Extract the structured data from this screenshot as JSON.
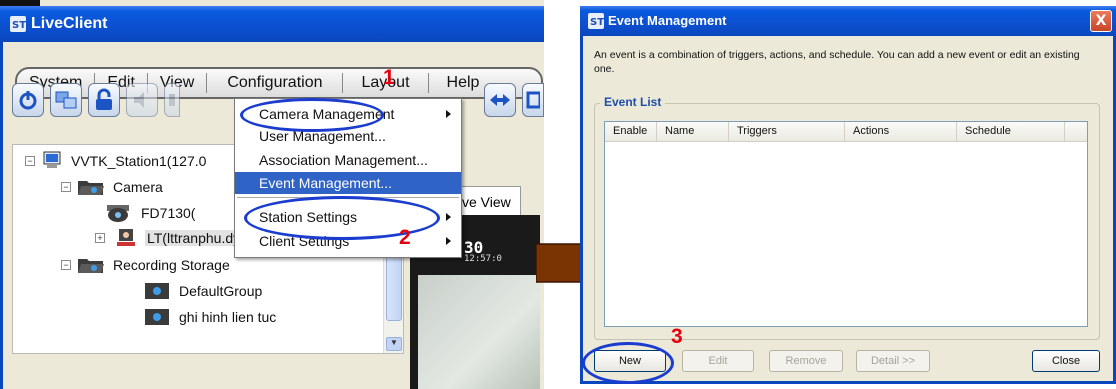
{
  "left_window": {
    "title": "LiveClient",
    "menu": [
      "System",
      "Edit",
      "View",
      "Configuration",
      "Layout",
      "Help"
    ],
    "toolbar_icons": [
      "power-icon",
      "network-computer-icon",
      "lock-icon",
      "volume-icon",
      "generic-icon",
      "arrows-icon"
    ],
    "tree": {
      "station": "VVTK_Station1(127.0",
      "camera_folder": "Camera",
      "camera_1": "FD7130(",
      "camera_2": "LT(lttranphu.dyndns.org)",
      "recording_folder": "Recording Storage",
      "group_1": "DefaultGroup",
      "group_2": "ghi hinh lien tuc"
    },
    "live_tab": "ve View",
    "video_label": "30",
    "video_time": "12:57:0",
    "dropdown": {
      "items": [
        "Camera Management",
        "User Management...",
        "Association Management...",
        "Event Management...",
        "Station Settings",
        "Client Settings"
      ],
      "highlighted": "Event Management..."
    }
  },
  "steps": [
    "1",
    "2",
    "3"
  ],
  "dialog": {
    "title": "Event Management",
    "description": "An event is a combination of triggers, actions, and schedule. You can add a new event or edit an existing one.",
    "group_label": "Event List",
    "columns": [
      "Enable",
      "Name",
      "Triggers",
      "Actions",
      "Schedule"
    ],
    "rows": [],
    "buttons": {
      "new": "New",
      "edit": "Edit",
      "remove": "Remove",
      "detail": "Detail >>",
      "close": "Close"
    },
    "close_glyph": "X"
  },
  "colors": {
    "titlebar": "#0a47bd",
    "highlight": "#2f63c6",
    "callout": "#1a3ccf",
    "step_number": "#e3000f",
    "arrow": "#7a3303"
  }
}
